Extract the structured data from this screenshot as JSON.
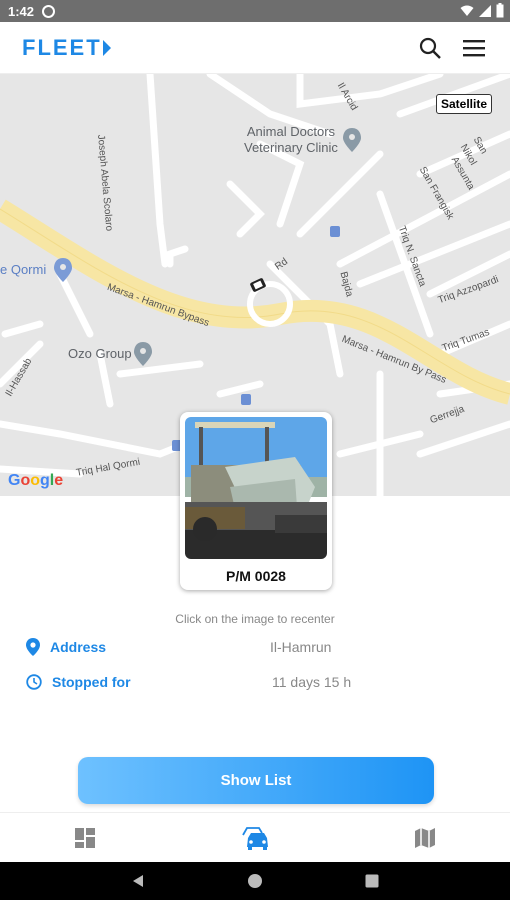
{
  "status_bar": {
    "time": "1:42"
  },
  "app": {
    "logo_text": "FLEET"
  },
  "map": {
    "satellite_label": "Satellite",
    "google_letters": [
      "G",
      "o",
      "o",
      "g",
      "l",
      "e"
    ],
    "google_colors": [
      "#4285f4",
      "#ea4335",
      "#fbbc05",
      "#4285f4",
      "#34a853",
      "#ea4335"
    ],
    "poi": {
      "vet_line1": "Animal Doctors",
      "vet_line2": "Veterinary Clinic",
      "ozo": "Ozo Group",
      "qormi": "e Qormi"
    },
    "streets": {
      "joseph": "Joseph Abela Scolaro",
      "bypass1": "Marsa - Hamrun Bypass",
      "bypass2": "Marsa - Hamrun By Pass",
      "hal_qormi": "Triq Hal Qormi",
      "sancta": "Triq N. Sancta",
      "azzopardi": "Triq Azzopardi",
      "tumas": "Triq Tumas",
      "san_frangisk": "San Frangisk",
      "assunta": "Assunta",
      "san_nikol": "San Nikol",
      "bajda": "Bajda",
      "gerrejja": "Gerrejja",
      "rd": "Rd",
      "il_arcid": "Il Arcid",
      "il_hassab": "Il-Hassab"
    }
  },
  "vehicle": {
    "name": "P/M 0028"
  },
  "hint": "Click on the image to recenter",
  "details": {
    "address_label": "Address",
    "address_value": "Il-Hamrun",
    "stopped_label": "Stopped for",
    "stopped_value": "11 days 15 h"
  },
  "actions": {
    "show_list": "Show List"
  },
  "colors": {
    "accent": "#1e88e5",
    "road_major": "#f7e6a4",
    "map_bg": "#e6e6e6"
  }
}
